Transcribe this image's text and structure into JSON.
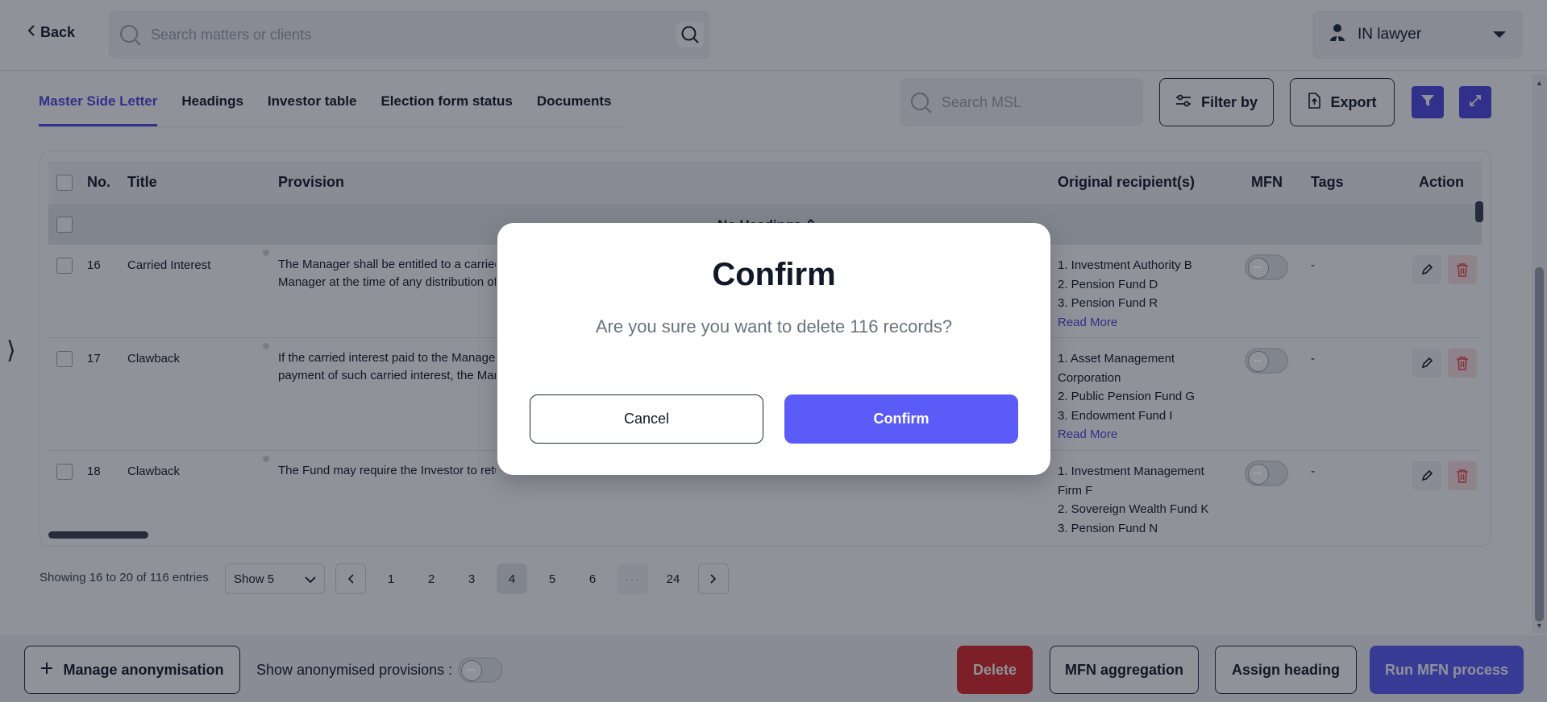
{
  "header": {
    "back_label": "Back",
    "search_placeholder": "Search matters or clients",
    "user_label": "IN lawyer"
  },
  "tabs": [
    {
      "label": "Master Side Letter",
      "active": true
    },
    {
      "label": "Headings"
    },
    {
      "label": "Investor table"
    },
    {
      "label": "Election form status"
    },
    {
      "label": "Documents"
    }
  ],
  "toolbar": {
    "search_placeholder": "Search MSL",
    "filter_label": "Filter by",
    "export_label": "Export"
  },
  "table": {
    "columns": {
      "no": "No.",
      "title": "Title",
      "provision": "Provision",
      "recipients": "Original recipient(s)",
      "mfn": "MFN",
      "tags": "Tags",
      "action": "Action"
    },
    "group_label": "No Headings",
    "read_more": "Read More",
    "rows": [
      {
        "no": "16",
        "title": "Carried Interest",
        "provision_line1": "The Manager shall be entitled to a carried",
        "provision_line2": "Manager at the time of any distribution of",
        "recipients": [
          "1. Investment Authority B",
          "2. Pension Fund D",
          "3. Pension Fund R"
        ],
        "tags": "-"
      },
      {
        "no": "17",
        "title": "Clawback",
        "provision_line1": "If the carried interest paid to the Manager",
        "provision_line2": "payment of such carried interest, the Man",
        "recipients": [
          "1. Asset Management",
          "Corporation",
          "2. Public Pension Fund G",
          "3. Endowment Fund I"
        ],
        "tags": "-"
      },
      {
        "no": "18",
        "title": "Clawback",
        "provision_line1": "The Fund may require the Investor to retu",
        "provision_line2": "",
        "recipients": [
          "1. Investment Management",
          "Firm F",
          "2. Sovereign Wealth Fund K",
          "3. Pension Fund N"
        ],
        "tags": "-"
      }
    ]
  },
  "pagination": {
    "showing": "Showing 16 to 20 of 116 entries",
    "show_label": "Show 5",
    "pages": [
      "1",
      "2",
      "3",
      "4",
      "5",
      "6",
      "···",
      "24"
    ],
    "current": "4"
  },
  "bottombar": {
    "manage_label": "Manage anonymisation",
    "show_anon_label": "Show anonymised provisions :",
    "delete_label": "Delete",
    "mfn_aggregation_label": "MFN aggregation",
    "assign_heading_label": "Assign heading",
    "run_mfn_label": "Run MFN process"
  },
  "modal": {
    "title": "Confirm",
    "message": "Are you sure you want to delete 116 records?",
    "cancel_label": "Cancel",
    "confirm_label": "Confirm"
  },
  "colors": {
    "accent": "#4f46e5",
    "primary_button": "#5b5bf7",
    "danger": "#dc2626"
  }
}
